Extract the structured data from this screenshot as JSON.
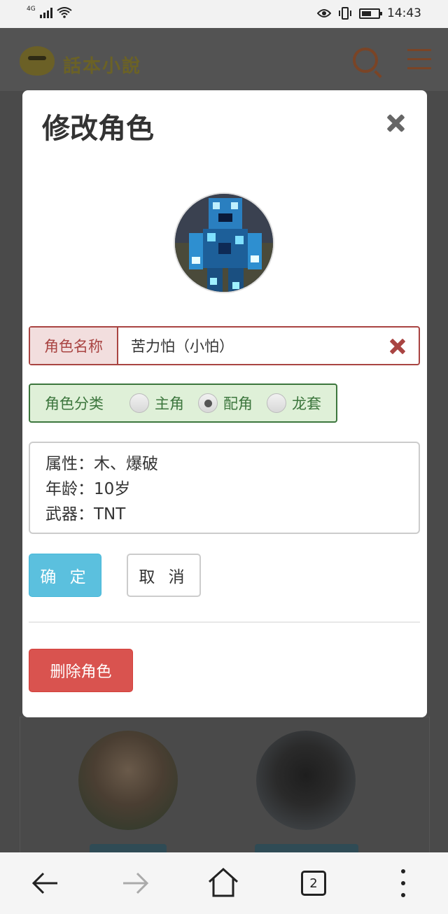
{
  "statusbar": {
    "network": "4G",
    "time": "14:43",
    "icons": [
      "signal-icon",
      "wifi-icon",
      "eye-icon",
      "vibrate-icon",
      "battery-icon"
    ]
  },
  "header": {
    "logo_text": "話本小說",
    "icons": [
      "logo-icon",
      "search-icon",
      "menu-icon"
    ],
    "accent_color": "#7a4426"
  },
  "modal": {
    "title": "修改角色",
    "close_icon": "close-icon",
    "name_label": "角色名称",
    "name_value": "苦力怕（小怕）",
    "category_label": "角色分类",
    "category_options": [
      {
        "label": "主角",
        "checked": false
      },
      {
        "label": "配角",
        "checked": true
      },
      {
        "label": "龙套",
        "checked": false
      }
    ],
    "description_lines": [
      "属性：木、爆破",
      "年龄：10岁",
      "武器：TNT"
    ],
    "confirm_label": "确 定",
    "cancel_label": "取 消",
    "delete_label": "删除角色",
    "colors": {
      "danger": "#a94442",
      "success": "#3c763d",
      "info_button": "#5bc0de",
      "delete_button": "#d9534f"
    }
  },
  "bottom_nav": {
    "tab_count": "2",
    "icons": [
      "back-arrow-icon",
      "forward-arrow-icon",
      "home-icon",
      "tabs-icon",
      "more-icon"
    ]
  }
}
